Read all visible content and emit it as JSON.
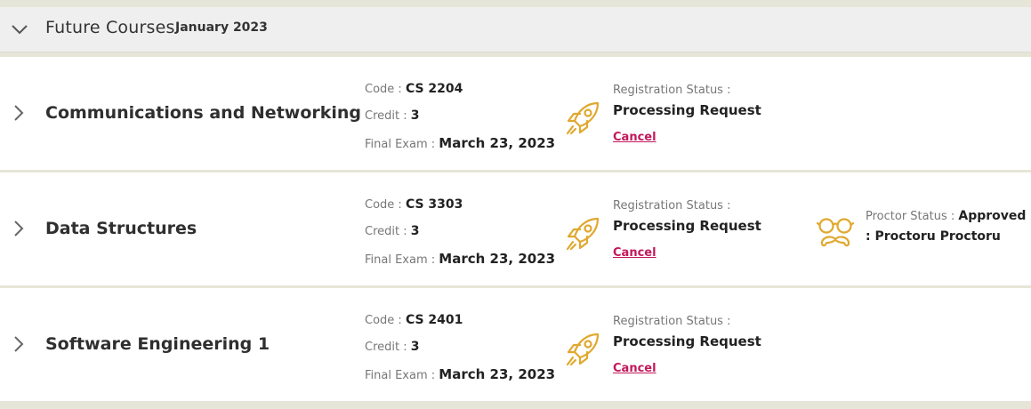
{
  "section": {
    "title": "Future Courses",
    "term": "January 2023"
  },
  "labels": {
    "code": "Code : ",
    "credit": "Credit : ",
    "final_exam": "Final Exam : ",
    "registration_status": "Registration Status : ",
    "proctor_status": "Proctor Status : ",
    "cancel": "Cancel"
  },
  "icons": {
    "section_toggle": "chevron-down-icon",
    "row_toggle": "chevron-right-icon",
    "registration": "rocket-icon",
    "proctor": "glasses-mustache-icon"
  },
  "colors": {
    "icon_gold": "#e0a82e",
    "cancel_link": "#c2185b"
  },
  "courses": [
    {
      "name": "Communications and Networking",
      "code": "CS 2204",
      "credit": "3",
      "final_exam": "March 23, 2023",
      "registration_status": "Processing Request"
    },
    {
      "name": "Data Structures",
      "code": "CS 3303",
      "credit": "3",
      "final_exam": "March 23, 2023",
      "registration_status": "Processing Request",
      "proctor_status": "Approved : Proctoru Proctoru"
    },
    {
      "name": "Software Engineering 1",
      "code": "CS 2401",
      "credit": "3",
      "final_exam": "March 23, 2023",
      "registration_status": "Processing Request"
    }
  ]
}
